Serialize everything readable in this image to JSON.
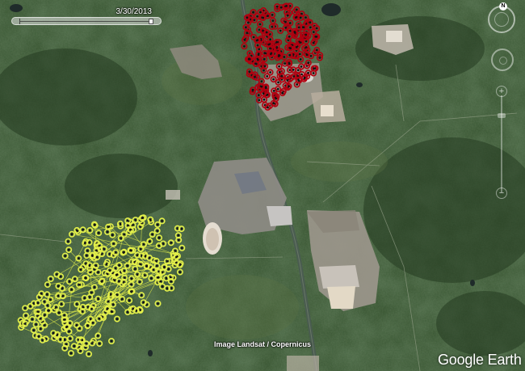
{
  "timeline": {
    "date": "3/30/2013"
  },
  "attribution": "Image Landsat / Copernicus",
  "logo": "Google Earth",
  "compass": {
    "north": "N"
  },
  "colors": {
    "terrain": "#2f4a2a",
    "forest_dark": "#24381f",
    "mine_gray": "#a9a39a",
    "tailings": "#d9cfc2",
    "river": "#4c5d5a",
    "red_track": "#b00010",
    "yellow_track": "#e4f04a",
    "white": "#ffffff"
  },
  "icons": [
    "compass-icon",
    "look-joystick-icon",
    "zoom-slider-icon"
  ],
  "overlays": [
    {
      "name": "red-placemark-cluster",
      "color": "#b00010",
      "marker": "ring"
    },
    {
      "name": "yellow-placemark-cluster",
      "color": "#e4f04a",
      "marker": "ring"
    }
  ]
}
